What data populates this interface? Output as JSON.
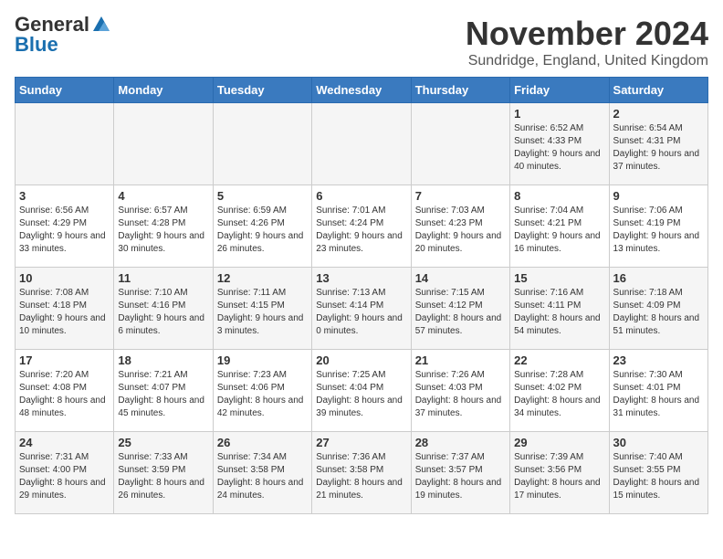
{
  "header": {
    "logo_general": "General",
    "logo_blue": "Blue",
    "month_title": "November 2024",
    "location": "Sundridge, England, United Kingdom"
  },
  "weekdays": [
    "Sunday",
    "Monday",
    "Tuesday",
    "Wednesday",
    "Thursday",
    "Friday",
    "Saturday"
  ],
  "weeks": [
    [
      {
        "day": "",
        "info": ""
      },
      {
        "day": "",
        "info": ""
      },
      {
        "day": "",
        "info": ""
      },
      {
        "day": "",
        "info": ""
      },
      {
        "day": "",
        "info": ""
      },
      {
        "day": "1",
        "info": "Sunrise: 6:52 AM\nSunset: 4:33 PM\nDaylight: 9 hours and 40 minutes."
      },
      {
        "day": "2",
        "info": "Sunrise: 6:54 AM\nSunset: 4:31 PM\nDaylight: 9 hours and 37 minutes."
      }
    ],
    [
      {
        "day": "3",
        "info": "Sunrise: 6:56 AM\nSunset: 4:29 PM\nDaylight: 9 hours and 33 minutes."
      },
      {
        "day": "4",
        "info": "Sunrise: 6:57 AM\nSunset: 4:28 PM\nDaylight: 9 hours and 30 minutes."
      },
      {
        "day": "5",
        "info": "Sunrise: 6:59 AM\nSunset: 4:26 PM\nDaylight: 9 hours and 26 minutes."
      },
      {
        "day": "6",
        "info": "Sunrise: 7:01 AM\nSunset: 4:24 PM\nDaylight: 9 hours and 23 minutes."
      },
      {
        "day": "7",
        "info": "Sunrise: 7:03 AM\nSunset: 4:23 PM\nDaylight: 9 hours and 20 minutes."
      },
      {
        "day": "8",
        "info": "Sunrise: 7:04 AM\nSunset: 4:21 PM\nDaylight: 9 hours and 16 minutes."
      },
      {
        "day": "9",
        "info": "Sunrise: 7:06 AM\nSunset: 4:19 PM\nDaylight: 9 hours and 13 minutes."
      }
    ],
    [
      {
        "day": "10",
        "info": "Sunrise: 7:08 AM\nSunset: 4:18 PM\nDaylight: 9 hours and 10 minutes."
      },
      {
        "day": "11",
        "info": "Sunrise: 7:10 AM\nSunset: 4:16 PM\nDaylight: 9 hours and 6 minutes."
      },
      {
        "day": "12",
        "info": "Sunrise: 7:11 AM\nSunset: 4:15 PM\nDaylight: 9 hours and 3 minutes."
      },
      {
        "day": "13",
        "info": "Sunrise: 7:13 AM\nSunset: 4:14 PM\nDaylight: 9 hours and 0 minutes."
      },
      {
        "day": "14",
        "info": "Sunrise: 7:15 AM\nSunset: 4:12 PM\nDaylight: 8 hours and 57 minutes."
      },
      {
        "day": "15",
        "info": "Sunrise: 7:16 AM\nSunset: 4:11 PM\nDaylight: 8 hours and 54 minutes."
      },
      {
        "day": "16",
        "info": "Sunrise: 7:18 AM\nSunset: 4:09 PM\nDaylight: 8 hours and 51 minutes."
      }
    ],
    [
      {
        "day": "17",
        "info": "Sunrise: 7:20 AM\nSunset: 4:08 PM\nDaylight: 8 hours and 48 minutes."
      },
      {
        "day": "18",
        "info": "Sunrise: 7:21 AM\nSunset: 4:07 PM\nDaylight: 8 hours and 45 minutes."
      },
      {
        "day": "19",
        "info": "Sunrise: 7:23 AM\nSunset: 4:06 PM\nDaylight: 8 hours and 42 minutes."
      },
      {
        "day": "20",
        "info": "Sunrise: 7:25 AM\nSunset: 4:04 PM\nDaylight: 8 hours and 39 minutes."
      },
      {
        "day": "21",
        "info": "Sunrise: 7:26 AM\nSunset: 4:03 PM\nDaylight: 8 hours and 37 minutes."
      },
      {
        "day": "22",
        "info": "Sunrise: 7:28 AM\nSunset: 4:02 PM\nDaylight: 8 hours and 34 minutes."
      },
      {
        "day": "23",
        "info": "Sunrise: 7:30 AM\nSunset: 4:01 PM\nDaylight: 8 hours and 31 minutes."
      }
    ],
    [
      {
        "day": "24",
        "info": "Sunrise: 7:31 AM\nSunset: 4:00 PM\nDaylight: 8 hours and 29 minutes."
      },
      {
        "day": "25",
        "info": "Sunrise: 7:33 AM\nSunset: 3:59 PM\nDaylight: 8 hours and 26 minutes."
      },
      {
        "day": "26",
        "info": "Sunrise: 7:34 AM\nSunset: 3:58 PM\nDaylight: 8 hours and 24 minutes."
      },
      {
        "day": "27",
        "info": "Sunrise: 7:36 AM\nSunset: 3:58 PM\nDaylight: 8 hours and 21 minutes."
      },
      {
        "day": "28",
        "info": "Sunrise: 7:37 AM\nSunset: 3:57 PM\nDaylight: 8 hours and 19 minutes."
      },
      {
        "day": "29",
        "info": "Sunrise: 7:39 AM\nSunset: 3:56 PM\nDaylight: 8 hours and 17 minutes."
      },
      {
        "day": "30",
        "info": "Sunrise: 7:40 AM\nSunset: 3:55 PM\nDaylight: 8 hours and 15 minutes."
      }
    ]
  ]
}
